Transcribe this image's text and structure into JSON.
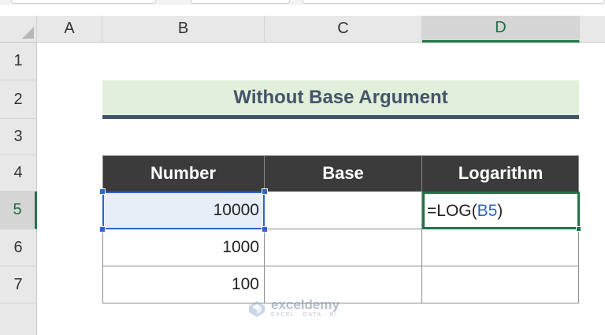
{
  "columns": [
    "A",
    "B",
    "C",
    "D"
  ],
  "rows": [
    "1",
    "2",
    "3",
    "4",
    "5",
    "6",
    "7"
  ],
  "active_column": "D",
  "active_row": "5",
  "banner": {
    "title": "Without Base Argument"
  },
  "table": {
    "headers": [
      "Number",
      "Base",
      "Logarithm"
    ],
    "rows": [
      {
        "number": "10000",
        "base": "",
        "logarithm": ""
      },
      {
        "number": "1000",
        "base": "",
        "logarithm": ""
      },
      {
        "number": "100",
        "base": "",
        "logarithm": ""
      }
    ]
  },
  "editing_formula": {
    "prefix": "=LOG(",
    "reference": "B5",
    "suffix": ")"
  },
  "watermark": {
    "name": "exceldemy",
    "tagline": "EXCEL · DATA · BI"
  },
  "colors": {
    "accent_green": "#217346",
    "reference_blue": "#2f64c8",
    "banner_fill": "#e2efda",
    "banner_text": "#44546a",
    "header_fill": "#3b3b3b"
  }
}
